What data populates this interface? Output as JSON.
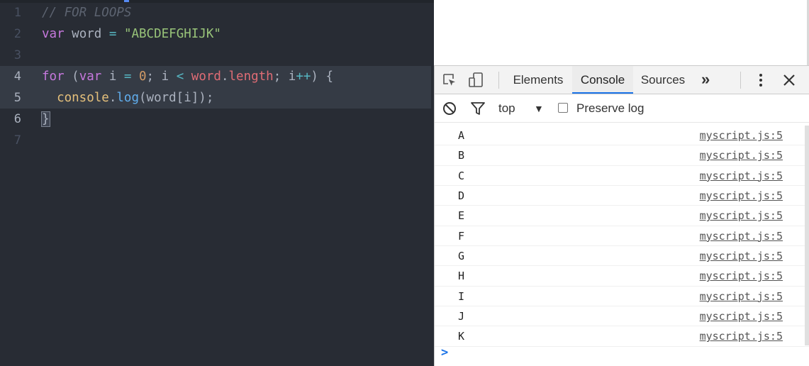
{
  "editor": {
    "lines": [
      {
        "n": "1"
      },
      {
        "n": "2"
      },
      {
        "n": "3"
      },
      {
        "n": "4"
      },
      {
        "n": "5"
      },
      {
        "n": "6"
      },
      {
        "n": "7"
      }
    ],
    "tokens": {
      "comment": "// FOR LOOPS",
      "kw_var": "var",
      "ident_word": "word",
      "eq": "=",
      "string": "\"ABCDEFGHIJK\"",
      "kw_for": "for",
      "paren_open": " (",
      "kw_var2": "var",
      "ident_i": " i ",
      "eq2": "=",
      "space": " ",
      "num_zero": "0",
      "semi_i": "; i ",
      "lt": "<",
      "word2": "word",
      "dot": ".",
      "prop_length": "length",
      "semi_i2": "; i",
      "incr": "++",
      "close_brace": ") {",
      "indent": "  ",
      "console_obj": "console",
      "dot2": ".",
      "log_fn": "log",
      "call_args": "(word[i]);",
      "rbrace": "}"
    }
  },
  "devtools": {
    "tabs": [
      {
        "label": "Elements"
      },
      {
        "label": "Console"
      },
      {
        "label": "Sources"
      }
    ],
    "more_tabs": "»",
    "context": "top",
    "context_arrow": "▼",
    "preserve_log_label": "Preserve log",
    "prompt_glyph": ">",
    "console_rows": [
      {
        "msg": "A",
        "src": "myscript.js:5"
      },
      {
        "msg": "B",
        "src": "myscript.js:5"
      },
      {
        "msg": "C",
        "src": "myscript.js:5"
      },
      {
        "msg": "D",
        "src": "myscript.js:5"
      },
      {
        "msg": "E",
        "src": "myscript.js:5"
      },
      {
        "msg": "F",
        "src": "myscript.js:5"
      },
      {
        "msg": "G",
        "src": "myscript.js:5"
      },
      {
        "msg": "H",
        "src": "myscript.js:5"
      },
      {
        "msg": "I",
        "src": "myscript.js:5"
      },
      {
        "msg": "J",
        "src": "myscript.js:5"
      },
      {
        "msg": "K",
        "src": "myscript.js:5"
      }
    ]
  },
  "icons": [
    "inspect-element-icon",
    "device-toolbar-icon",
    "kebab-menu-icon",
    "close-icon",
    "clear-console-icon",
    "filter-icon",
    "chevron-right-icon"
  ],
  "colors": {
    "editor_bg": "#282c34",
    "accent": "#1a73e8"
  }
}
